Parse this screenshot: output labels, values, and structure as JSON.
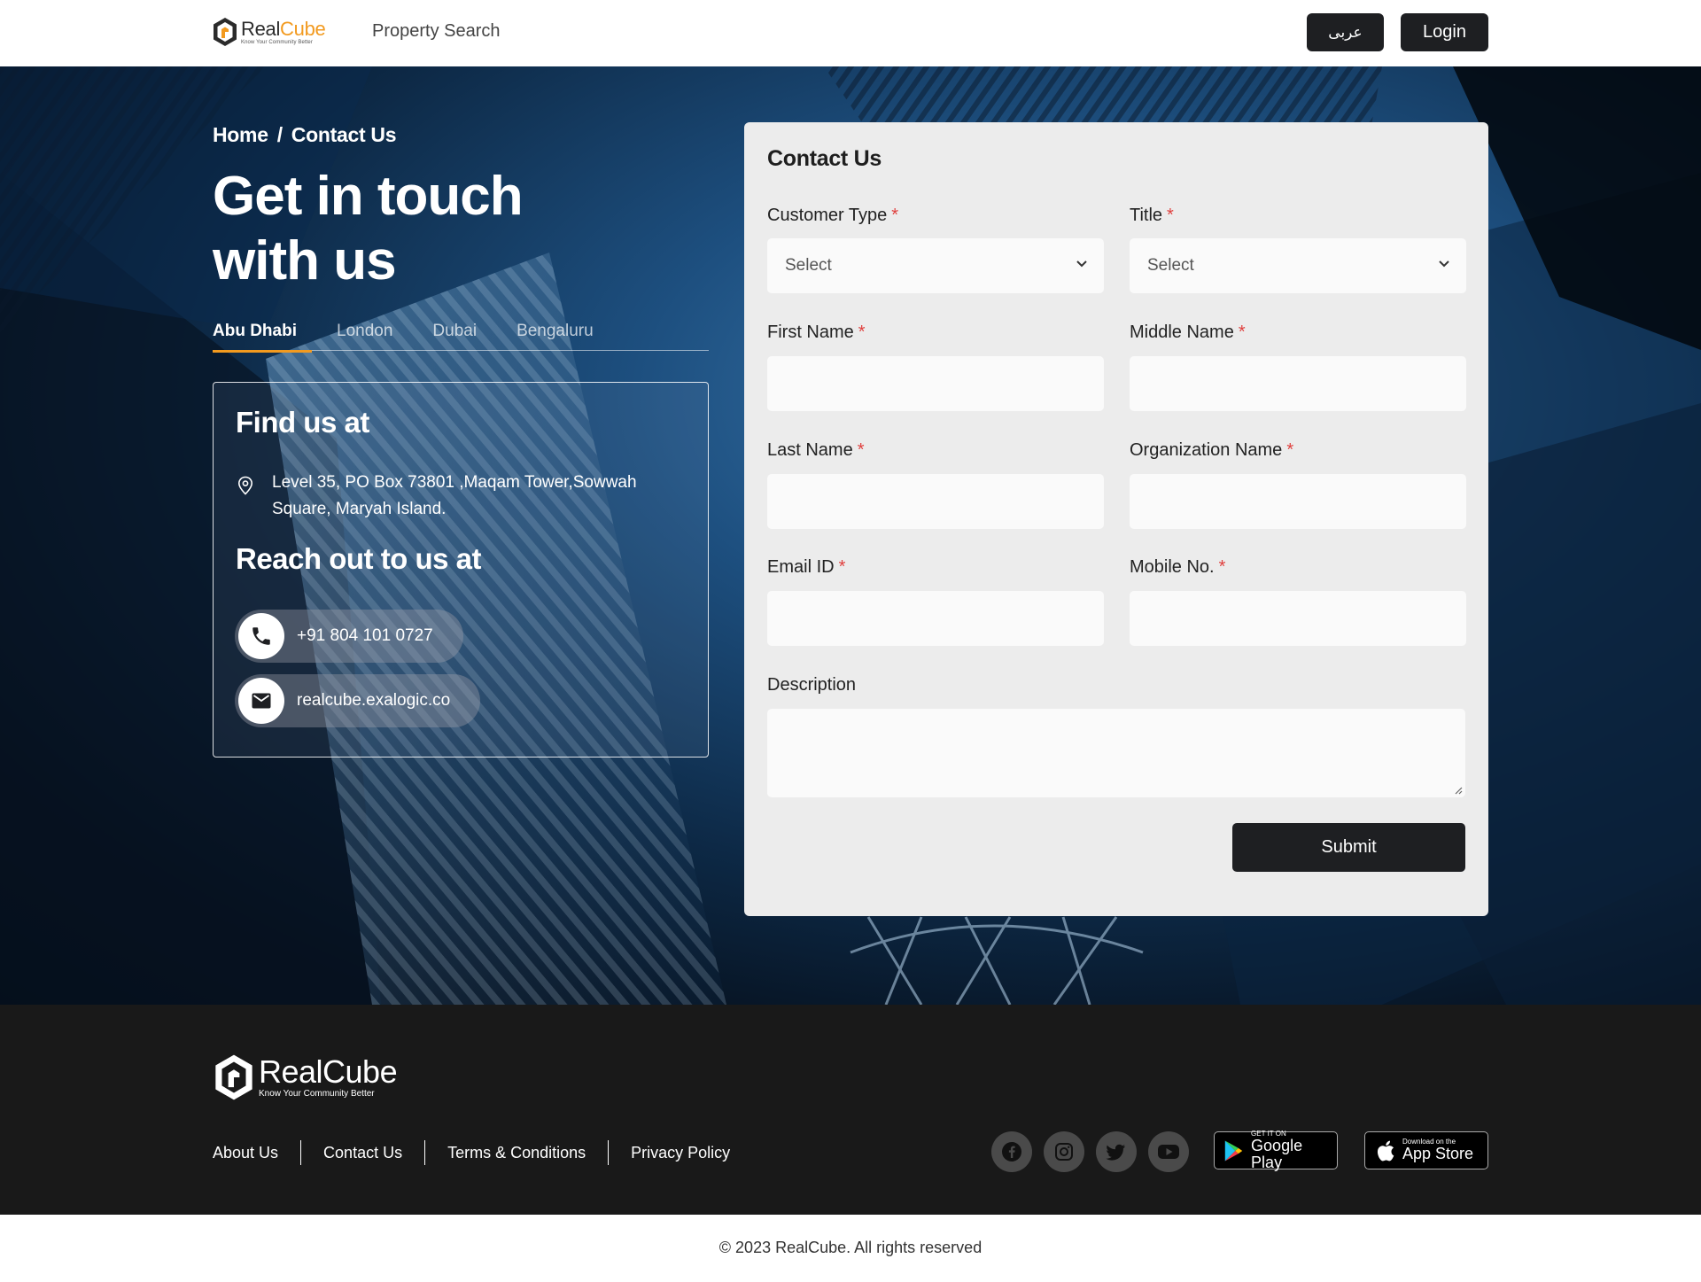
{
  "header": {
    "logo_word_1": "Real",
    "logo_word_2": "Cube",
    "logo_tagline": "Know Your Community Better",
    "nav_property_search": "Property Search",
    "btn_arabic": "عربى",
    "btn_login": "Login"
  },
  "hero": {
    "breadcrumb_home": "Home",
    "breadcrumb_sep": "/",
    "breadcrumb_current": "Contact Us",
    "headline": "Get in touch with us",
    "cities": [
      "Abu Dhabi",
      "London",
      "Dubai",
      "Bengaluru"
    ],
    "active_city": "Abu Dhabi",
    "find_title": "Find us at",
    "address": "Level 35, PO Box 73801 ,Maqam Tower,Sowwah Square, Maryah Island.",
    "reach_title": "Reach out to us at",
    "phone": "+91 804 101 0727",
    "email": "realcube.exalogic.co"
  },
  "form": {
    "title": "Contact Us",
    "customer_type_label": "Customer Type",
    "customer_type_value": "Select",
    "title_label": "Title",
    "title_value": "Select",
    "first_name_label": "First Name",
    "middle_name_label": "Middle Name",
    "last_name_label": "Last Name",
    "organization_label": "Organization Name",
    "email_label": "Email ID",
    "mobile_label": "Mobile No.",
    "description_label": "Description",
    "required_mark": "*",
    "submit_label": "Submit"
  },
  "footer": {
    "logo_word": "RealCube",
    "logo_tagline": "Know Your Community Better",
    "links": [
      "About Us",
      "Contact Us",
      "Terms & Conditions",
      "Privacy Policy"
    ],
    "social_icons": [
      "facebook-icon",
      "instagram-icon",
      "twitter-icon",
      "youtube-icon"
    ],
    "google_play_small": "GET IT ON",
    "google_play_big": "Google Play",
    "app_store_small": "Download on the",
    "app_store_big": "App Store"
  },
  "copyright": "© 2023 RealCube. All rights reserved",
  "colors": {
    "accent": "#f29a1f",
    "dark_button": "#1e1f22",
    "footer_bg": "#191919",
    "form_bg": "#ececec",
    "required": "#e0403e"
  }
}
